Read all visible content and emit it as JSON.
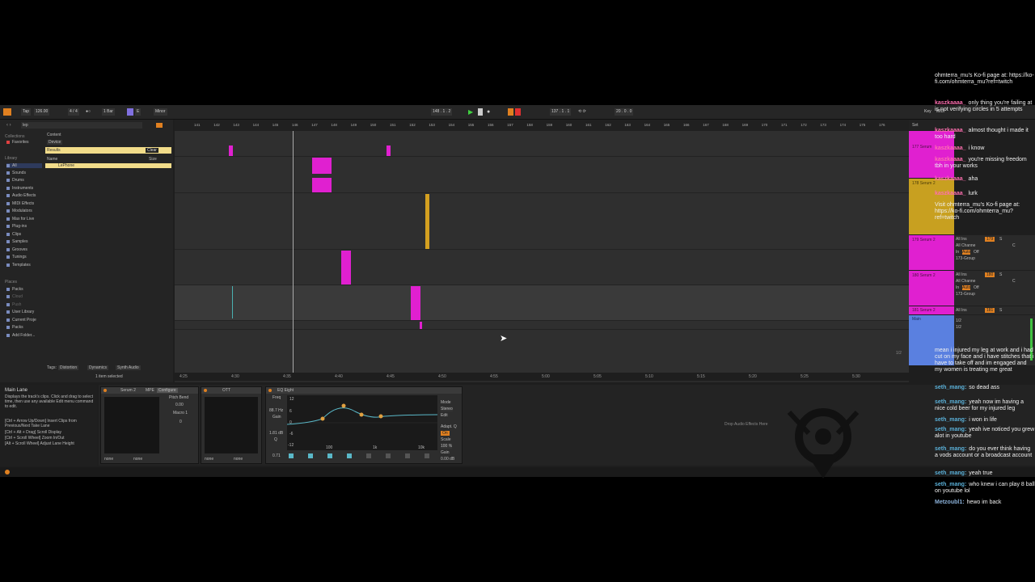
{
  "transport": {
    "tap": "Tap",
    "bpm": "126.00",
    "signature": "4 / 4",
    "metronome": "1 Bar",
    "key": "E",
    "scale": "Minor",
    "position": "148 . 1 . 2",
    "loop_start": "137 . 1 . 1",
    "loop_length": "20 . 0 . 0",
    "key_label": "Key",
    "midi_label": "MIDI"
  },
  "browser": {
    "search_value": "lep",
    "content_label": "Content",
    "device_label": "Device",
    "results_label": "Results",
    "clear_label": "Clear",
    "name_header": "Name",
    "size_header": "Size",
    "result_item": "LePhone",
    "collections_header": "Collections",
    "favorites": "Favorites",
    "library_header": "Library",
    "library_items": [
      "All",
      "Sounds",
      "Drums",
      "Instruments",
      "Audio Effects",
      "MIDI Effects",
      "Modulators",
      "Max for Live",
      "Plug-ins",
      "Clips",
      "Samples",
      "Grooves",
      "Tunings",
      "Templates"
    ],
    "places_header": "Places",
    "places_items": [
      "Packs",
      "Cloud",
      "Push",
      "User Library",
      "Current Proje",
      "Packs",
      "Add Folder..."
    ],
    "tags_label": "Tags:",
    "tags": [
      "Distortion",
      "Dynamics",
      "Synth Audio"
    ],
    "status": "1 item selected"
  },
  "arrangement": {
    "bar_numbers": [
      "141",
      "142",
      "143",
      "144",
      "145",
      "146",
      "147",
      "148",
      "149",
      "150",
      "151",
      "152",
      "153",
      "154",
      "155",
      "156",
      "157",
      "158",
      "159",
      "160",
      "161",
      "162",
      "163",
      "164",
      "165",
      "166",
      "167",
      "168",
      "169",
      "170",
      "171",
      "172",
      "173",
      "174",
      "175",
      "176"
    ],
    "time_marks": [
      "4:25",
      "4:30",
      "4:35",
      "4:40",
      "4:45",
      "4:50",
      "4:55",
      "5:00",
      "5:05",
      "5:10",
      "5:15",
      "5:20",
      "5:25",
      "5:30"
    ],
    "lanes": [
      {
        "name": "",
        "color": "#e020d0"
      },
      {
        "name": "177 Serum",
        "color": "#e020d0"
      },
      {
        "name": "178 Serum 2",
        "color": "#c8a020"
      },
      {
        "name": "179 Serum 2",
        "color": "#e020d0"
      },
      {
        "name": "180 Serum 2",
        "color": "#e020d0"
      },
      {
        "name": "181 Serum 2",
        "color": "#e020d0"
      },
      {
        "name": "Main",
        "color": "#5a80e0"
      }
    ],
    "page": "1/2",
    "set_label": "Set",
    "io_all_ins": "All Ins",
    "io_all_channels": "All Channe",
    "io_in": "In",
    "io_auto": "Auto",
    "io_off": "Off",
    "io_group": "173-Group",
    "vol_178": "178",
    "vol_179": "179",
    "vol_180": "180",
    "vol_181": "181",
    "pan_c": "C",
    "s_label": "S",
    "main_outs": [
      "1/2",
      "1/2"
    ]
  },
  "info": {
    "title": "Main Lane",
    "text": "Displays the track's clips. Click and drag to select time, then use any available Edit menu command to edit.",
    "shortcuts": [
      "[Ctrl + Arrow Up/Down] Insert Clips from Previous/Next Take Lane",
      "[Ctrl + Alt + Drag] Scroll Display",
      "[Ctrl + Scroll Wheel] Zoom In/Out",
      "[Alt + Scroll Wheel] Adjust Lane Height"
    ]
  },
  "devices": {
    "serum_name": "Serum 2",
    "mpe": "MPE",
    "configure": "Configure",
    "pitch_bend": "Pitch Bend",
    "pitch_value": "0.00",
    "macro": "Macro 1",
    "macro_value": "0",
    "none_label": "none",
    "ott_name": "OTT",
    "eq_name": "EQ Eight",
    "eq_freq_label": "Freq",
    "eq_freq": "88.7 Hz",
    "eq_gain_label": "Gain",
    "eq_gain": "1.81 dB",
    "eq_q_label": "Q",
    "eq_q": "0.71",
    "eq_mode_label": "Mode",
    "eq_mode": "Stereo",
    "eq_edit": "Edit",
    "eq_adapt": "Adapt. Q",
    "eq_adapt_state": "On",
    "eq_scale_label": "Scale",
    "eq_scale": "100 %",
    "eq_out_label": "Gain",
    "eq_out": "0.00 dB",
    "eq_axis": [
      "100",
      "1k",
      "10k"
    ],
    "eq_gain_axis": [
      "12",
      "6",
      "0",
      "-6",
      "-12"
    ],
    "drop_hint": "Drop Audio Effects Here"
  },
  "chat": [
    {
      "user": "",
      "text": "ohmterra_mu's Ko-fi page at: https://ko-fi.com/ohmterra_mu?ref=twitch",
      "color": "#ffffff"
    },
    {
      "user": "kaszkaaaa_",
      "text": "only thing you're failing at is not verifying circles in 5 attempts",
      "color": "#ff6fb0"
    },
    {
      "user": "kaszkaaaa_",
      "text": "almost thought i made it too hard",
      "color": "#ff6fb0"
    },
    {
      "user": "kaszkaaaa_",
      "text": "i know",
      "color": "#ff6fb0"
    },
    {
      "user": "kaszkaaaa_",
      "text": "you're missing freedom tbh in your works",
      "color": "#ff6fb0"
    },
    {
      "user": "kaszkaaaa_",
      "text": "aha",
      "color": "#ff6fb0"
    },
    {
      "user": "kaszkaaaa_",
      "text": "lurk",
      "color": "#ff6fb0"
    },
    {
      "user": "",
      "text": "Visit ohmterra_mu's Ko-fi page at: https://ko-fi.com/ohmterra_mu?ref=twitch",
      "color": "#ffffff"
    },
    {
      "user": "",
      "text": "mean i injured my leg at work and i had cut on my face and i have stitches that i have to take off and im engaged and my women is treating me great",
      "color": "#ffffff"
    },
    {
      "user": "seth_mang:",
      "text": "so dead ass",
      "color": "#5ab0d8"
    },
    {
      "user": "seth_mang:",
      "text": "yeah now im having a nice cold beer for my injured leg",
      "color": "#5ab0d8"
    },
    {
      "user": "seth_mang:",
      "text": "i won in life",
      "color": "#5ab0d8"
    },
    {
      "user": "seth_mang:",
      "text": "yeah ive noticed you grew alot in youtube",
      "color": "#5ab0d8"
    },
    {
      "user": "seth_mang:",
      "text": "do you ever think having a vods account or a broadcast account",
      "color": "#5ab0d8"
    },
    {
      "user": "seth_mang:",
      "text": "yeah true",
      "color": "#5ab0d8"
    },
    {
      "user": "seth_mang:",
      "text": "who knew i can play 8 ball on youtube lol",
      "color": "#5ab0d8"
    },
    {
      "user": "Metzoubl1:",
      "text": "hewo im back",
      "color": "#8ab0d8"
    }
  ]
}
